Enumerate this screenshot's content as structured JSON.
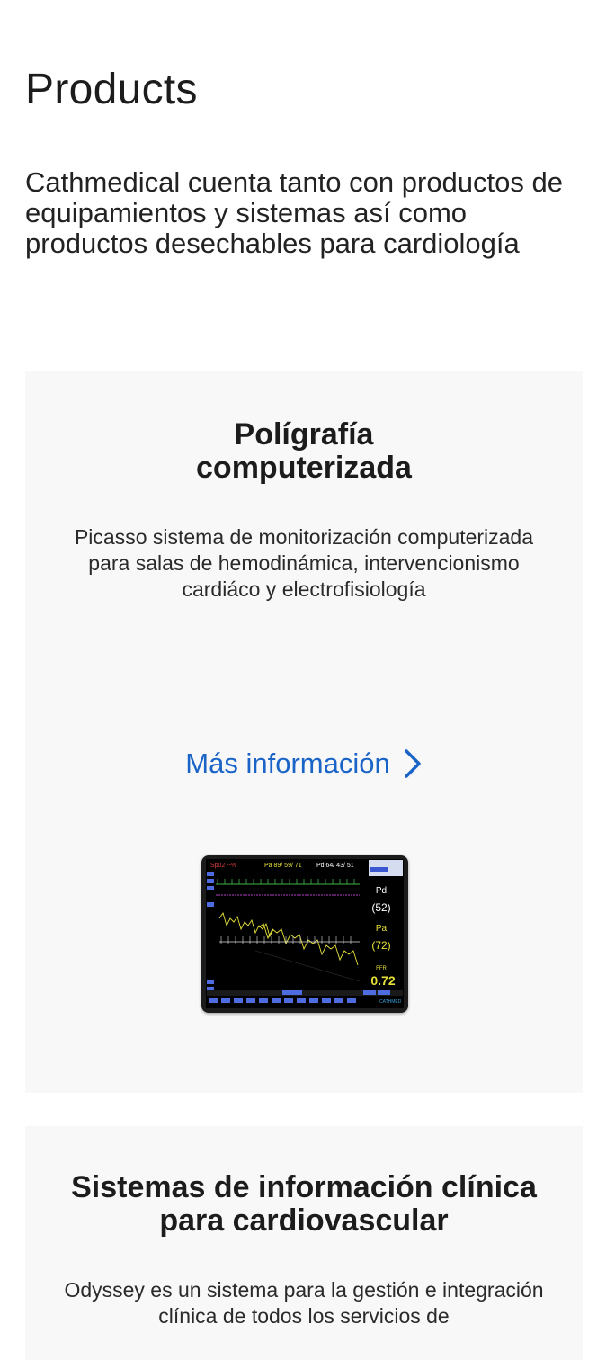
{
  "page": {
    "title": "Products",
    "intro": "Cathmedical cuenta tanto con productos de equipamientos y sistemas así como productos desechables para cardiología"
  },
  "cards": [
    {
      "title": "Polígrafía computerizada",
      "description": "Picasso sistema de monitorización computerizada para salas de hemodinámica, intervencionismo cardiáco y electrofisiología",
      "link_label": "Más información",
      "link_icon": "chevron-right-icon",
      "image": {
        "icon": "monitor-screen-image",
        "header_spo2": "Sp02 --%",
        "header_pa": "Pa 89/ 59/ 71",
        "header_pd": "Pd 64/ 43/ 51",
        "pd_label": "Pd",
        "pd_value": "(52)",
        "pa_label": "Pa",
        "pa_value": "(72)",
        "ffr_label": "FFR",
        "ffr_value": "0.72",
        "brand": "CATHMED"
      }
    },
    {
      "title": "Sistemas de información clínica para cardiovascular",
      "description": "Odyssey es un sistema para la gestión e integración clínica de todos los servicios de"
    }
  ],
  "colors": {
    "link": "#1a64c8",
    "card_bg": "#f8f8f8",
    "text": "#1c1c1c"
  }
}
